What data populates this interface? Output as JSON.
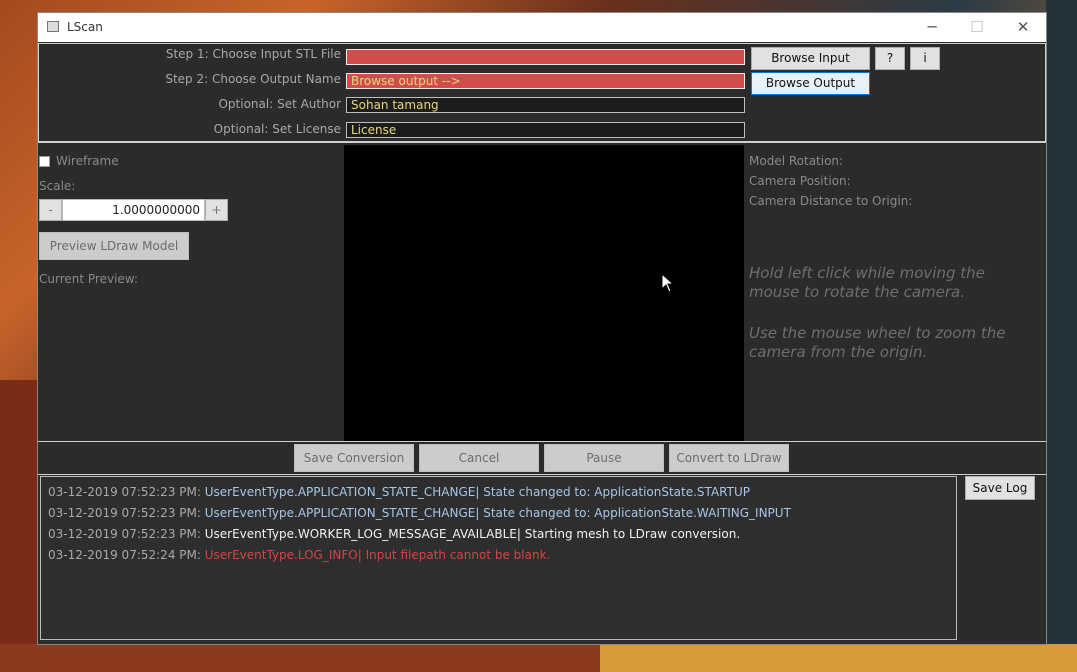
{
  "window": {
    "title": "LScan",
    "controls": {
      "minimize": "─",
      "maximize": "☐",
      "close": "✕"
    }
  },
  "inputs": {
    "step1_label": "Step 1: Choose Input STL File",
    "step1_value": "",
    "step2_label": "Step 2: Choose Output Name",
    "step2_value": "Browse output -->",
    "author_label": "Optional: Set Author",
    "author_value": "Sohan tamang",
    "license_label": "Optional: Set License",
    "license_value": "License"
  },
  "buttons": {
    "browse_input": "Browse Input",
    "browse_output": "Browse Output",
    "help": "?",
    "info": "i",
    "preview": "Preview LDraw Model",
    "save_conversion": "Save Conversion",
    "cancel": "Cancel",
    "pause": "Pause",
    "convert": "Convert to LDraw",
    "save_log": "Save Log"
  },
  "left_panel": {
    "wireframe_label": "Wireframe",
    "wireframe_checked": false,
    "scale_label": "Scale:",
    "scale_minus": "-",
    "scale_value": "1.0000000000",
    "scale_plus": "+",
    "current_preview_label": "Current Preview:"
  },
  "right_panel": {
    "model_rotation": "Model Rotation:",
    "camera_position": "Camera Position:",
    "camera_distance": "Camera Distance to Origin:",
    "hint1": "Hold left click while moving the mouse to rotate the camera.",
    "hint2": "Use the mouse wheel to zoom the camera from the origin."
  },
  "log": [
    {
      "time": "03-12-2019 07:52:23 PM:",
      "message": "UserEventType.APPLICATION_STATE_CHANGE| State changed to: ApplicationState.STARTUP",
      "color": "#a8c6e6"
    },
    {
      "time": "03-12-2019 07:52:23 PM:",
      "message": "UserEventType.APPLICATION_STATE_CHANGE| State changed to: ApplicationState.WAITING_INPUT",
      "color": "#a8c6e6"
    },
    {
      "time": "03-12-2019 07:52:23 PM:",
      "message": "UserEventType.WORKER_LOG_MESSAGE_AVAILABLE| Starting mesh to LDraw conversion.",
      "color": "#f2f2f2"
    },
    {
      "time": "03-12-2019 07:52:24 PM:",
      "message": "UserEventType.LOG_INFO| Input filepath cannot be blank.",
      "color": "#d44545"
    }
  ],
  "colors": {
    "error_field": "#d44b4b",
    "field_text": "#e6d77a",
    "panel_bg": "#2b2b2b"
  }
}
